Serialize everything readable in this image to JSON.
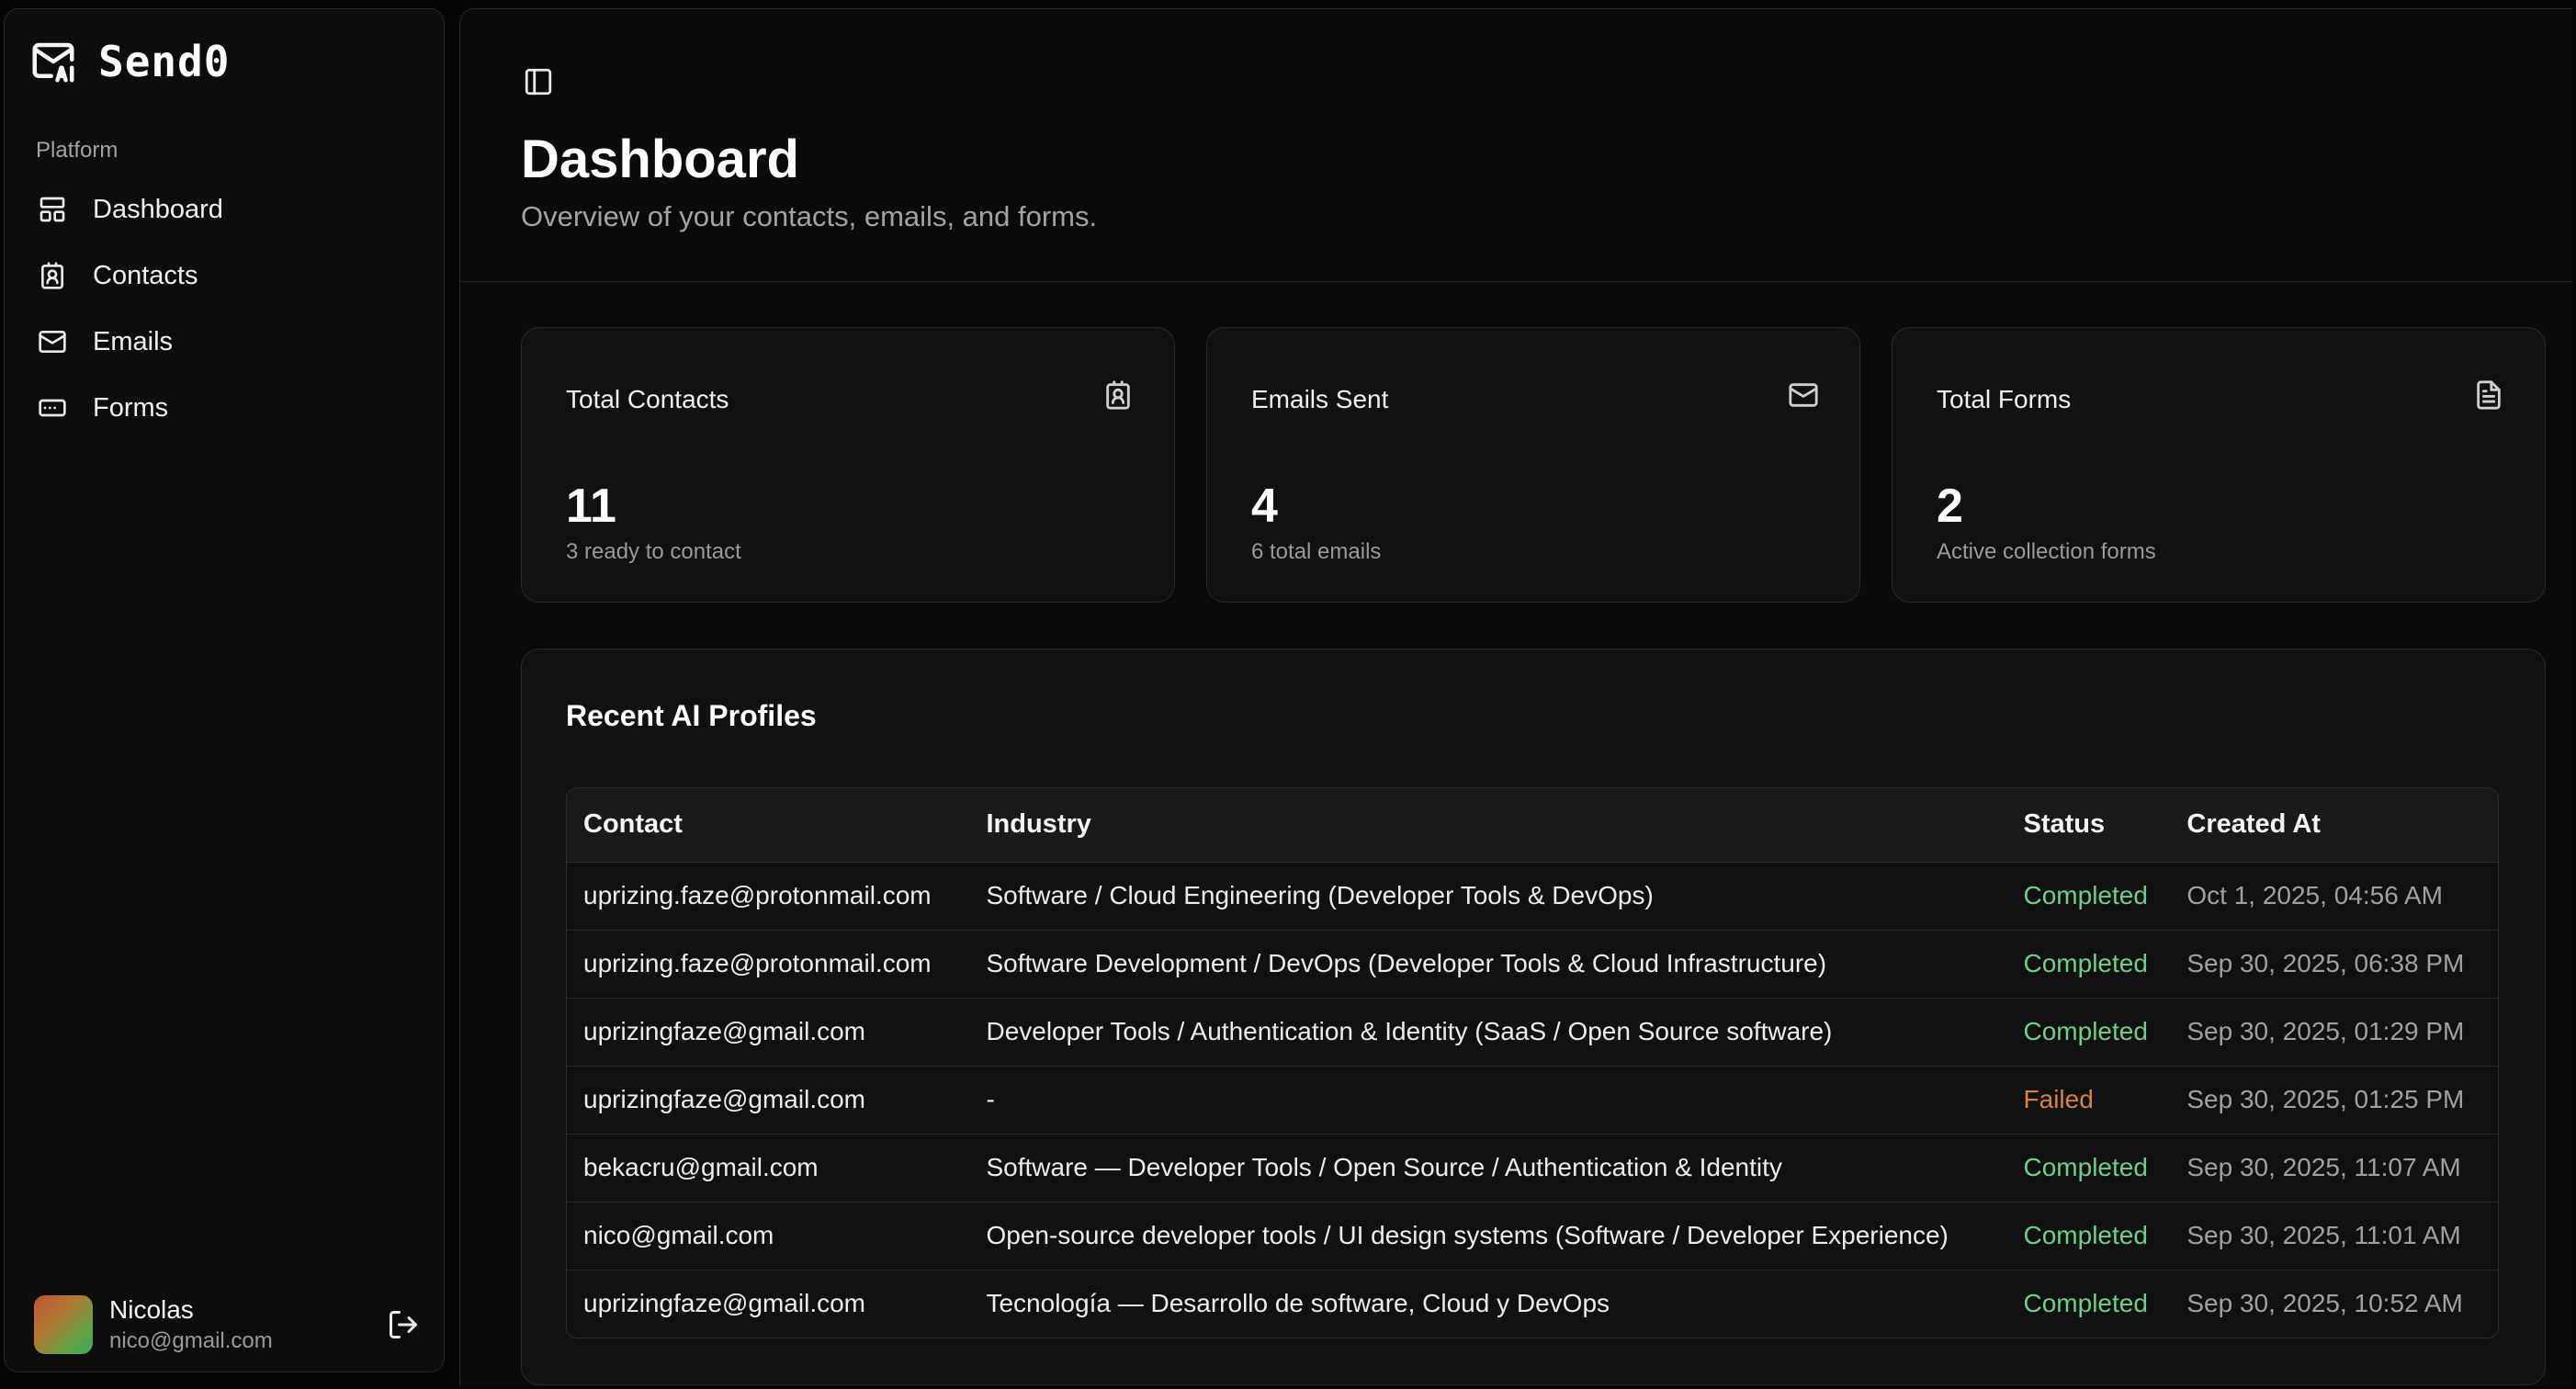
{
  "app": {
    "brand_name": "Send0",
    "logo_icon": "mail-ai-icon"
  },
  "sidebar": {
    "group_label": "Platform",
    "items": [
      {
        "label": "Dashboard",
        "icon": "layout-dashboard-icon"
      },
      {
        "label": "Contacts",
        "icon": "contact-icon"
      },
      {
        "label": "Emails",
        "icon": "mail-icon"
      },
      {
        "label": "Forms",
        "icon": "form-input-icon"
      }
    ],
    "user": {
      "name": "Nicolas",
      "email": "nico@gmail.com",
      "logout_icon": "log-out-icon"
    }
  },
  "header": {
    "title": "Dashboard",
    "subtitle": "Overview of your contacts, emails, and forms."
  },
  "stats": [
    {
      "title": "Total Contacts",
      "value": "11",
      "sub": "3 ready to contact",
      "icon": "contact-icon"
    },
    {
      "title": "Emails Sent",
      "value": "4",
      "sub": "6 total emails",
      "icon": "mail-icon"
    },
    {
      "title": "Total Forms",
      "value": "2",
      "sub": "Active collection forms",
      "icon": "file-text-icon"
    }
  ],
  "profiles": {
    "title": "Recent AI Profiles",
    "columns": [
      "Contact",
      "Industry",
      "Status",
      "Created At"
    ],
    "rows": [
      {
        "contact": "uprizing.faze@protonmail.com",
        "industry": "Software / Cloud Engineering (Developer Tools & DevOps)",
        "status": "Completed",
        "created": "Oct 1, 2025, 04:56 AM"
      },
      {
        "contact": "uprizing.faze@protonmail.com",
        "industry": "Software Development / DevOps (Developer Tools & Cloud Infrastructure)",
        "status": "Completed",
        "created": "Sep 30, 2025, 06:38 PM"
      },
      {
        "contact": "uprizingfaze@gmail.com",
        "industry": "Developer Tools / Authentication & Identity (SaaS / Open Source software)",
        "status": "Completed",
        "created": "Sep 30, 2025, 01:29 PM"
      },
      {
        "contact": "uprizingfaze@gmail.com",
        "industry": "-",
        "status": "Failed",
        "created": "Sep 30, 2025, 01:25 PM"
      },
      {
        "contact": "bekacru@gmail.com",
        "industry": "Software — Developer Tools / Open Source / Authentication & Identity",
        "status": "Completed",
        "created": "Sep 30, 2025, 11:07 AM"
      },
      {
        "contact": "nico@gmail.com",
        "industry": "Open-source developer tools / UI design systems (Software / Developer Experience)",
        "status": "Completed",
        "created": "Sep 30, 2025, 11:01 AM"
      },
      {
        "contact": "uprizingfaze@gmail.com",
        "industry": "Tecnología — Desarrollo de software, Cloud y DevOps",
        "status": "Completed",
        "created": "Sep 30, 2025, 10:52 AM"
      }
    ]
  },
  "colors": {
    "completed": "#6fcf86",
    "failed": "#d9813f",
    "background": "#0a0a0a"
  }
}
